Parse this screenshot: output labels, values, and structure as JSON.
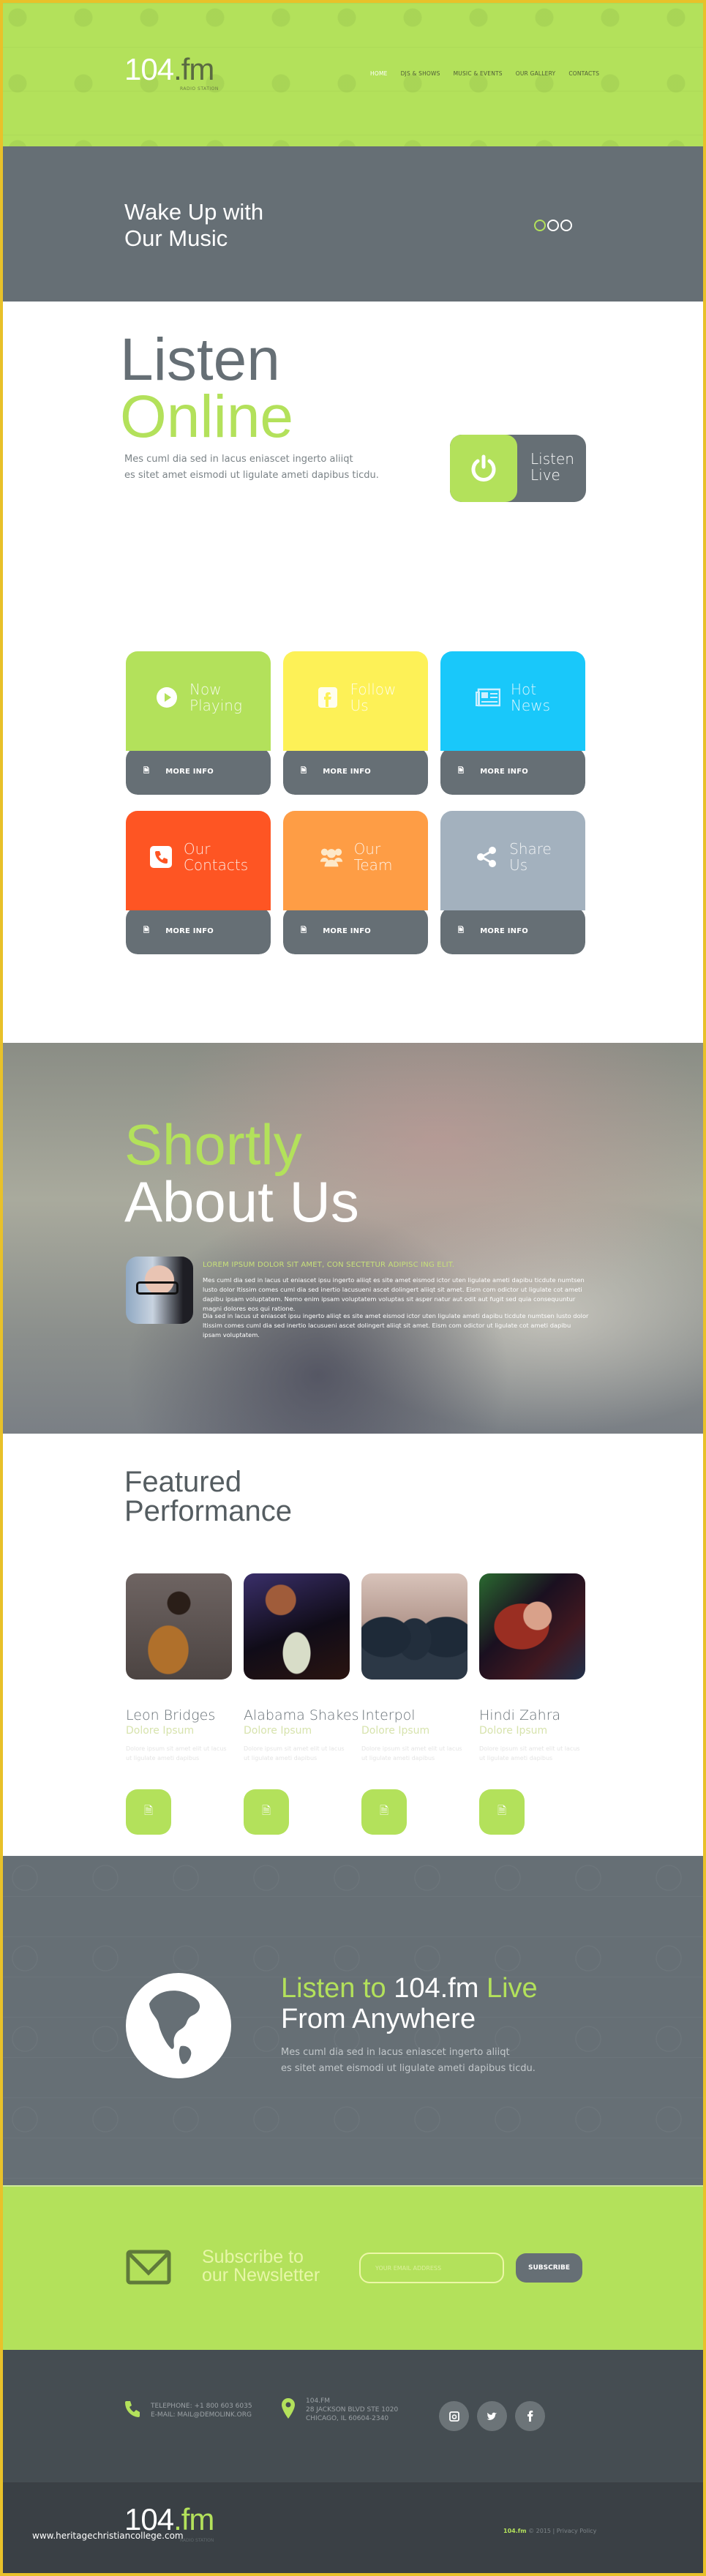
{
  "header": {
    "logo_main": "104",
    "logo_fm": ".fm",
    "logo_sub": "RADIO STATION",
    "nav": [
      {
        "label": "HOME",
        "active": true
      },
      {
        "label": "DJS & SHOWS",
        "active": false
      },
      {
        "label": "MUSIC & EVENTS",
        "active": false
      },
      {
        "label": "OUR GALLERY",
        "active": false
      },
      {
        "label": "CONTACTS",
        "active": false
      }
    ]
  },
  "hero": {
    "title_line1": "Wake Up with",
    "title_line2": "Our Music",
    "slides": 3,
    "active_slide": 1
  },
  "listen": {
    "title_line1": "Listen",
    "title_line2": "Online",
    "text_line1": "Mes cuml dia sed in lacus eniascet ingerto aliiqt",
    "text_line2": "es sitet amet eismodi ut ligulate ameti dapibus ticdu.",
    "button_line1": "Listen",
    "button_line2": "Live",
    "button_icon": "power-icon"
  },
  "tiles": [
    {
      "line1": "Now",
      "line2": "Playing",
      "icon": "play-icon",
      "color": "#b3e15b",
      "more": "MORE INFO"
    },
    {
      "line1": "Follow",
      "line2": "Us",
      "icon": "facebook-icon",
      "color": "#fdf157",
      "more": "MORE INFO"
    },
    {
      "line1": "Hot",
      "line2": "News",
      "icon": "newspaper-icon",
      "color": "#19c8fa",
      "more": "MORE INFO"
    },
    {
      "line1": "Our",
      "line2": "Contacts",
      "icon": "phone-icon",
      "color": "#fe5523",
      "more": "MORE INFO"
    },
    {
      "line1": "Our",
      "line2": "Team",
      "icon": "team-icon",
      "color": "#fe9d45",
      "more": "MORE INFO"
    },
    {
      "line1": "Share",
      "line2": "Us",
      "icon": "share-icon",
      "color": "#a3b1be",
      "more": "MORE INFO"
    }
  ],
  "about": {
    "title_line1": "Shortly",
    "title_line2": "About Us",
    "lead": "LOREM IPSUM DOLOR SIT AMET, CON SECTETUR ADIPISC ING ELIT.",
    "para1": "Mes cuml dia sed in lacus ut eniascet ipsu ingerto aliiqt es site amet eismod ictor uten ligulate ameti dapibu ticdute numtsen lusto dolor ltissim comes cuml dia sed inertio lacusueni ascet dolingert aliiqt sit amet. Eism com odictor ut ligulate cot ameti dapibu ipsam voluptatem. Nemo enim ipsam voluptatem voluptas sit asper natur aut odit aut fugit sed quia consequuntur magni dolores eos qui ratione.",
    "para2": "Dia sed in lacus ut eniascet ipsu ingerto aliiqt es site amet eismod ictor uten ligulate ameti dapibu ticdute numtsen lusto dolor ltissim comes cuml dia sed inertio lacusueni ascet dolingert aliiqt sit amet. Eism com odictor ut ligulate cot ameti dapibu ipsam voluptatem."
  },
  "featured": {
    "title_line1": "Featured",
    "title_line2": "Performance",
    "artists": [
      {
        "name": "Leon Bridges",
        "sub": "Dolore Ipsum",
        "desc": "Dolore ipsum sit amet elit ut lacus ut ligulate ameti dapibus"
      },
      {
        "name": "Alabama Shakes",
        "sub": "Dolore Ipsum",
        "desc": "Dolore ipsum sit amet elit ut lacus ut ligulate ameti dapibus"
      },
      {
        "name": "Interpol",
        "sub": "Dolore Ipsum",
        "desc": "Dolore ipsum sit amet elit ut lacus ut ligulate ameti dapibus"
      },
      {
        "name": "Hindi Zahra",
        "sub": "Dolore Ipsum",
        "desc": "Dolore ipsum sit amet elit ut lacus ut ligulate ameti dapibus"
      }
    ]
  },
  "live": {
    "title_a": "Listen to ",
    "title_b": "104.fm",
    "title_c": " Live",
    "title_line2": "From Anywhere",
    "text_line1": "Mes cuml dia sed in lacus eniascet ingerto aliiqt",
    "text_line2": "es sitet amet eismodi ut ligulate ameti dapibus ticdu."
  },
  "newsletter": {
    "title_line1": "Subscribe to",
    "title_line2": "our Newsletter",
    "placeholder": "YOUR EMAIL ADDRESS",
    "button": "SUBSCRIBE"
  },
  "footer": {
    "phone": "TELEPHONE: +1 800 603 6035",
    "email": "E-MAIL: MAIL@DEMOLINK.ORG",
    "addr1": "104.FM",
    "addr2": "28 JACKSON BLVD STE 1020",
    "addr3": "CHICAGO, IL 60604-2340",
    "socials": [
      "instagram",
      "twitter",
      "facebook"
    ],
    "logo_main": "104",
    "logo_fm": ".fm",
    "logo_sub": "RADIO STATION",
    "copy_brand": "104.fm",
    "copy_rest": " © 2015 | Privacy Policy",
    "watermark": "www.heritagechristiancollege.com"
  },
  "colors": {
    "accent": "#b3e15b",
    "slate": "#666f75",
    "footer_dark": "#3a4045"
  }
}
